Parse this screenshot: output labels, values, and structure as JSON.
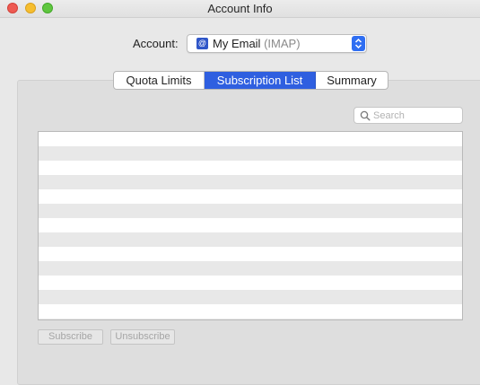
{
  "window": {
    "title": "Account Info"
  },
  "account": {
    "label": "Account:",
    "selected_name": "My Email",
    "selected_type": "(IMAP)",
    "icon": "at-sign-icon",
    "accent_color": "#2f6ef2"
  },
  "tabs": [
    {
      "label": "Quota Limits",
      "selected": false
    },
    {
      "label": "Subscription List",
      "selected": true
    },
    {
      "label": "Summary",
      "selected": false
    }
  ],
  "search": {
    "placeholder": "Search",
    "value": ""
  },
  "subscription_list": {
    "rows": []
  },
  "buttons": {
    "subscribe": "Subscribe",
    "unsubscribe": "Unsubscribe"
  }
}
